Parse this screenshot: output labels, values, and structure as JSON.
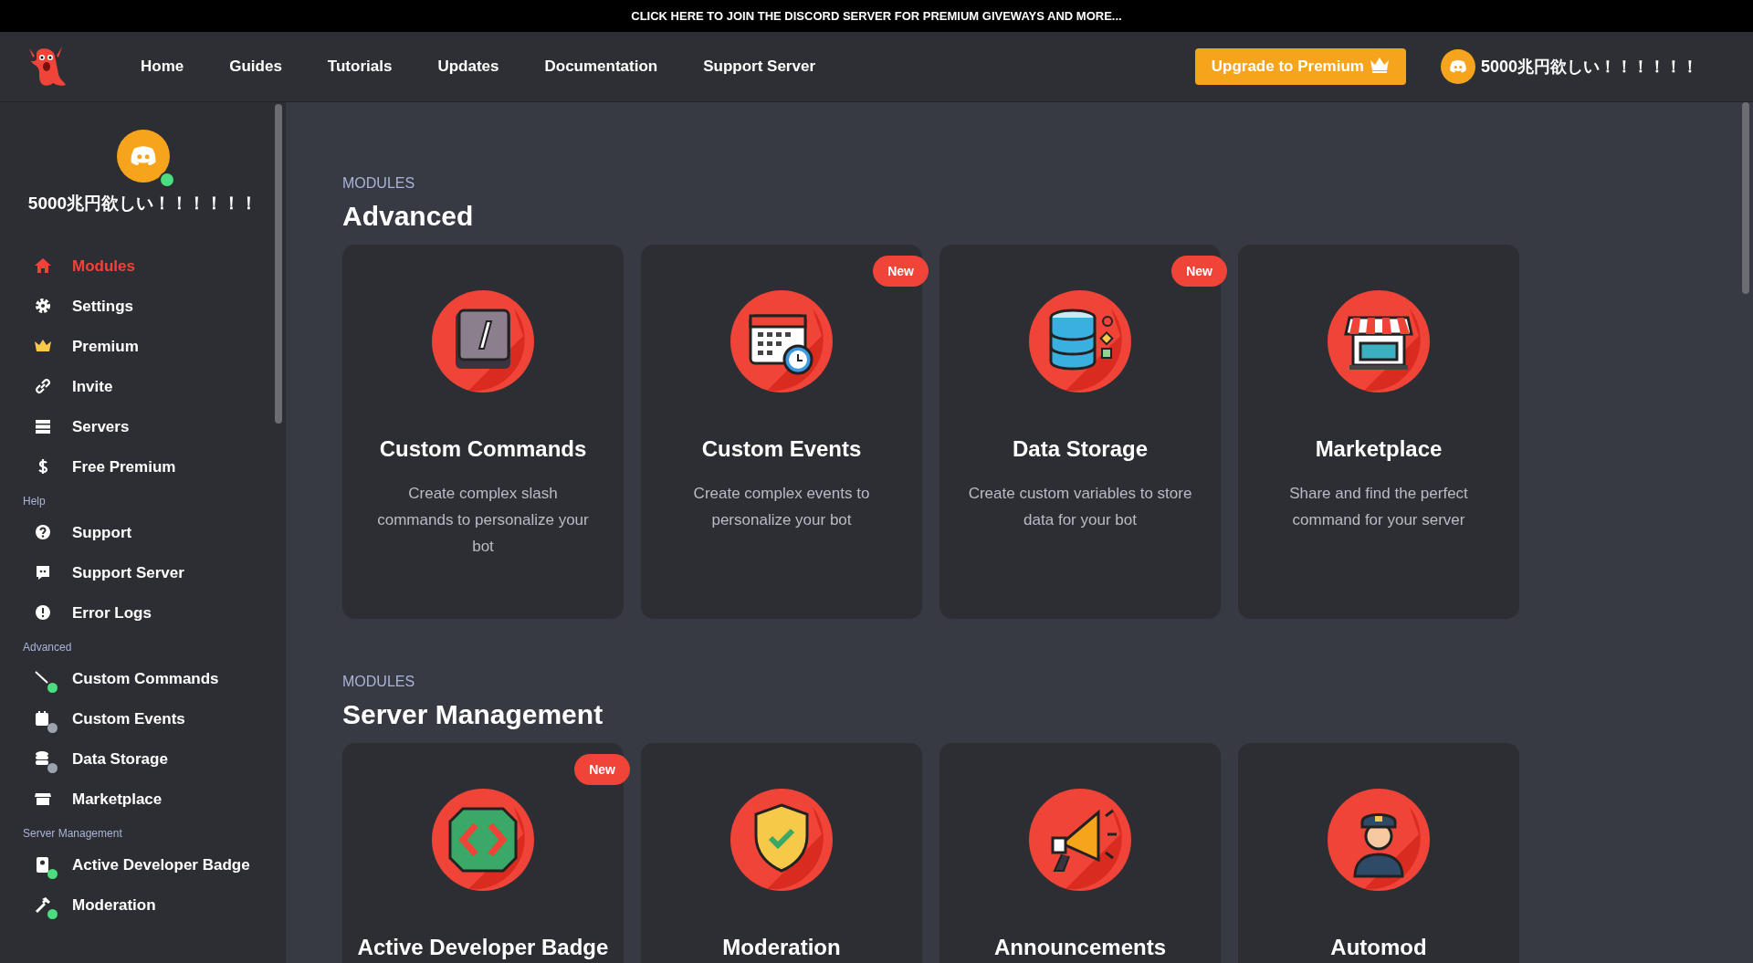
{
  "banner": {
    "text": "CLICK HERE TO JOIN THE DISCORD SERVER FOR **PREMIUM GIVEWAYS** AND MORE..."
  },
  "nav": {
    "links": [
      "Home",
      "Guides",
      "Tutorials",
      "Updates",
      "Documentation",
      "Support Server"
    ],
    "upgrade_button": "Upgrade to Premium",
    "user": "5000兆円欲しい！！！！！！"
  },
  "sidebar": {
    "user": {
      "name": "5000兆円欲しい！！！！！！",
      "online": true
    },
    "sections": [
      {
        "items": [
          {
            "label": "Modules",
            "selected": true
          },
          {
            "label": "Settings",
            "selected": false
          },
          {
            "label": "Premium",
            "selected": false
          },
          {
            "label": "Invite",
            "selected": false
          },
          {
            "label": "Servers",
            "selected": false
          },
          {
            "label": "Free Premium",
            "selected": false
          }
        ]
      },
      {
        "title": "Help",
        "items": [
          {
            "label": "Support",
            "selected": false
          },
          {
            "label": "Support Server",
            "selected": false
          },
          {
            "label": "Error Logs",
            "selected": false
          }
        ]
      },
      {
        "title": "Advanced",
        "items": [
          {
            "label": "Custom Commands",
            "selected": false,
            "color": "#4ade80"
          },
          {
            "label": "Custom Events",
            "selected": false,
            "color": "#9ca3af"
          },
          {
            "label": "Data Storage",
            "selected": false,
            "color": "#9ca3af"
          },
          {
            "label": "Marketplace",
            "selected": false
          }
        ]
      },
      {
        "title": "Server Management",
        "items": [
          {
            "label": "Active Developer Badge",
            "selected": false,
            "color": "#4ade80"
          },
          {
            "label": "Moderation",
            "selected": false,
            "color": "#4ade80"
          }
        ]
      }
    ]
  },
  "module_sections": [
    {
      "eyebrow": "MODULES",
      "title": "Advanced",
      "cards": [
        {
          "title": "Custom Commands",
          "description": "Create complex slash commands to personalize your bot",
          "new": false
        },
        {
          "title": "Custom Events",
          "description": "Create complex events to personalize your bot",
          "new": true,
          "badge": "New"
        },
        {
          "title": "Data Storage",
          "description": "Create custom variables to store data for your bot",
          "new": true,
          "badge": "New"
        },
        {
          "title": "Marketplace",
          "description": "Share and find the perfect command for your server",
          "new": false
        }
      ]
    },
    {
      "eyebrow": "MODULES",
      "title": "Server Management",
      "cards": [
        {
          "title": "Active Developer Badge",
          "new": true,
          "badge": "New"
        },
        {
          "title": "Moderation",
          "new": false
        },
        {
          "title": "Announcements",
          "new": false
        },
        {
          "title": "Automod",
          "new": false
        }
      ]
    }
  ]
}
